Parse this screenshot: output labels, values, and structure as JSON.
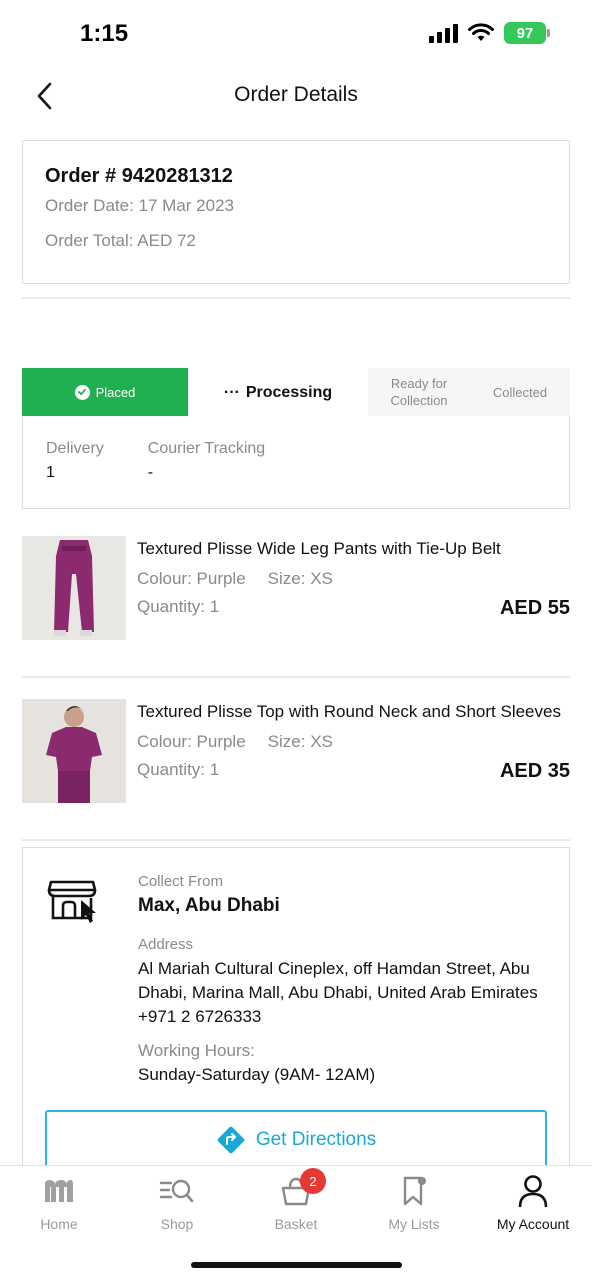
{
  "status_bar": {
    "time": "1:15",
    "battery": "97"
  },
  "header": {
    "title": "Order Details"
  },
  "order": {
    "number": "Order # 9420281312",
    "date": "Order Date: 17 Mar 2023",
    "total": "Order Total: AED 72"
  },
  "status_steps": {
    "placed": "Placed",
    "processing": "Processing",
    "ready_line1": "Ready for",
    "ready_line2": "Collection",
    "collected": "Collected"
  },
  "tracking": {
    "delivery_label": "Delivery",
    "delivery_value": "1",
    "courier_label": "Courier Tracking",
    "courier_value": "-"
  },
  "products": [
    {
      "name": "Textured Plisse Wide Leg Pants with Tie-Up Belt",
      "colour": "Colour: Purple",
      "size": "Size: XS",
      "quantity": "Quantity: 1",
      "price": "AED 55"
    },
    {
      "name": "Textured Plisse Top with Round Neck and Short Sleeves",
      "colour": "Colour: Purple",
      "size": "Size: XS",
      "quantity": "Quantity: 1",
      "price": "AED 35"
    }
  ],
  "store": {
    "collect_label": "Collect From",
    "name": "Max, Abu Dhabi",
    "address_label": "Address",
    "address": "Al Mariah Cultural Cineplex, off Hamdan Street, Abu Dhabi, Marina Mall, Abu Dhabi, United Arab Emirates",
    "phone": "+971 2 6726333",
    "hours_label": "Working Hours:",
    "hours": "Sunday-Saturday (9AM- 12AM)",
    "directions_label": "Get Directions"
  },
  "bottom_nav": {
    "items": [
      {
        "label": "Home",
        "icon": "max-logo-icon"
      },
      {
        "label": "Shop",
        "icon": "shop-search-icon"
      },
      {
        "label": "Basket",
        "icon": "basket-icon",
        "badge": "2"
      },
      {
        "label": "My Lists",
        "icon": "bookmark-icon"
      },
      {
        "label": "My Account",
        "icon": "account-icon",
        "active": true
      }
    ]
  },
  "colors": {
    "accent_green": "#20b050",
    "link_blue": "#1aa8d8",
    "badge_red": "#e53935"
  }
}
